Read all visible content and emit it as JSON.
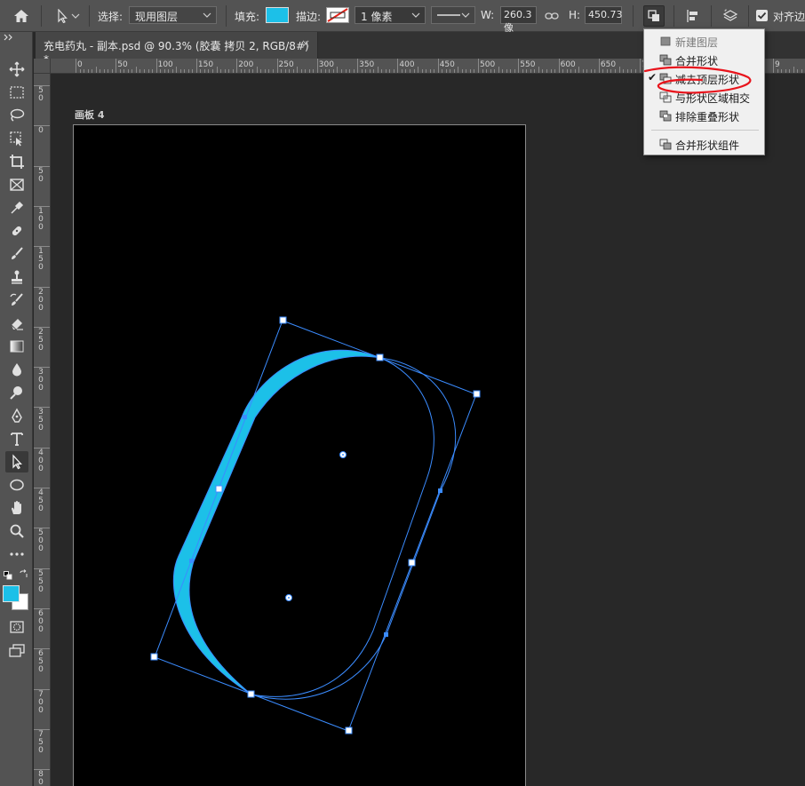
{
  "options_bar": {
    "select_label": "选择:",
    "select_value": "现用图层",
    "fill_label": "填充:",
    "fill_color": "#1cc0e8",
    "stroke_label": "描边:",
    "stroke_width": "1 像素",
    "w_label": "W:",
    "w_value": "260.3 像",
    "h_label": "H:",
    "h_value": "450.73",
    "align_edges_label": "对齐边"
  },
  "document_tab": {
    "title": "充电药丸 - 副本.psd @ 90.3% (胶囊 拷贝 2, RGB/8#) *",
    "close": "×"
  },
  "artboard": {
    "label": "画板 4"
  },
  "ruler_h": [
    "0",
    "50",
    "100",
    "150",
    "200",
    "250",
    "300",
    "350",
    "400",
    "450",
    "500",
    "550",
    "600",
    "650",
    "7",
    "9"
  ],
  "ruler_v": [
    "5\n0",
    "0",
    "5\n0",
    "1\n0\n0",
    "1\n5\n0",
    "2\n0\n0",
    "2\n5\n0",
    "3\n0\n0",
    "3\n5\n0",
    "4\n0\n0",
    "4\n5\n0",
    "5\n0\n0",
    "5\n5\n0",
    "6\n0\n0",
    "6\n5\n0",
    "7\n0\n0",
    "7\n5\n0",
    "8\n0"
  ],
  "path_menu": {
    "items": [
      {
        "label": "新建图层",
        "disabled": true,
        "checked": false,
        "icon": "new-layer-icon"
      },
      {
        "label": "合并形状",
        "disabled": false,
        "checked": false,
        "icon": "combine-shapes-icon"
      },
      {
        "label": "减去顶层形状",
        "disabled": false,
        "checked": true,
        "icon": "subtract-front-shape-icon"
      },
      {
        "label": "与形状区域相交",
        "disabled": false,
        "checked": false,
        "icon": "intersect-shape-areas-icon"
      },
      {
        "label": "排除重叠形状",
        "disabled": false,
        "checked": false,
        "icon": "exclude-overlapping-shapes-icon"
      },
      {
        "label": "合并形状组件",
        "disabled": false,
        "checked": false,
        "icon": "merge-shape-components-icon"
      }
    ],
    "check_mark": "✔"
  },
  "colors": {
    "foreground": "#1cc0e8",
    "background": "#ffffff",
    "path_outline": "#3b8cff",
    "annotation": "#e8141c"
  }
}
